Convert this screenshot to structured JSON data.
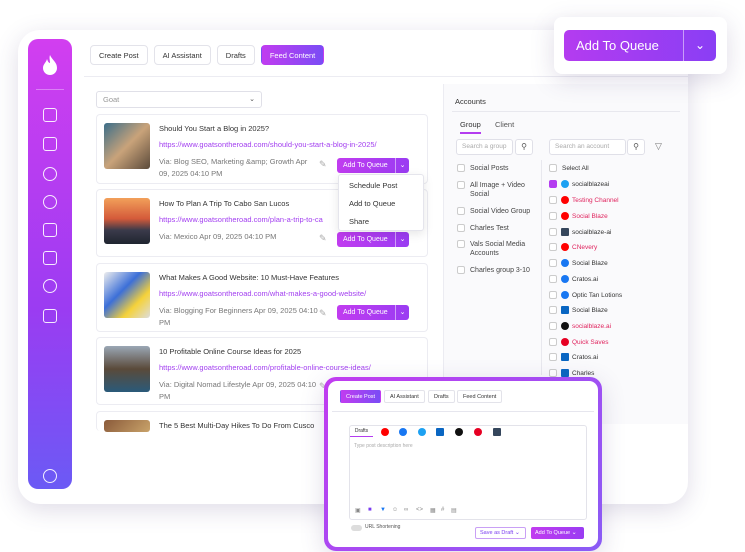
{
  "tabs": [
    "Create Post",
    "AI Assistant",
    "Drafts",
    "Feed Content"
  ],
  "feed_select": {
    "value": "Goat"
  },
  "cards": [
    {
      "title": "Should You Start a Blog in 2025?",
      "url": "https://www.goatsontheroad.com/should-you-start-a-blog-in-2025/",
      "via": "Via: Blog SEO, Marketing &amp; Growth  Apr 09, 2025 04:10 PM",
      "queue": "Add To Queue"
    },
    {
      "title": "How To Plan A Trip To Cabo San Lucos",
      "url": "https://www.goatsontheroad.com/plan-a-trip-to-ca",
      "via": "Via: Mexico   Apr 09, 2025 04:10 PM",
      "queue": "Add To Queue"
    },
    {
      "title": "What Makes A Good Website: 10 Must-Have Features",
      "url": "https://www.goatsontheroad.com/what-makes-a-good-website/",
      "via": "Via: Blogging For Beginners  Apr 09, 2025 04:10 PM",
      "queue": "Add To Queue"
    },
    {
      "title": "10 Profitable Online Course Ideas for 2025",
      "url": "https://www.goatsontheroad.com/profitable-online-course-ideas/",
      "via": "Via: Digital Nomad Lifestyle  Apr 09, 2025 04:10 PM",
      "queue": "Add To Queue"
    },
    {
      "title": "The 5 Best Multi-Day Hikes To Do From Cusco",
      "url": "",
      "via": "",
      "queue": ""
    }
  ],
  "menu": [
    "Schedule Post",
    "Add to Queue",
    "Share"
  ],
  "accounts_panel": {
    "title": "Accounts",
    "tabs": [
      "Group",
      "Client"
    ],
    "group_search_placeholder": "Search a group",
    "account_search_placeholder": "Search an account",
    "groups": [
      "Social Posts",
      "All Image + Video Social",
      "Social Video Group",
      "Charles Test",
      "Vals Social Media Accounts",
      "Charles group 3-10"
    ],
    "select_all": "Select All",
    "accounts": [
      {
        "name": "socialblazeai",
        "checked": true,
        "color": "#1da1f2",
        "error": false
      },
      {
        "name": "Testing Channel",
        "checked": false,
        "color": "#ff0000",
        "error": true
      },
      {
        "name": "Social Blaze",
        "checked": false,
        "color": "#ff0000",
        "error": true
      },
      {
        "name": "socialblaze-ai",
        "checked": false,
        "color": "#35465c",
        "error": false
      },
      {
        "name": "CNevery",
        "checked": false,
        "color": "#ff0000",
        "error": true
      },
      {
        "name": "Social Blaze",
        "checked": false,
        "color": "#1877f2",
        "error": false
      },
      {
        "name": "Cratos.ai",
        "checked": false,
        "color": "#1877f2",
        "error": false
      },
      {
        "name": "Optic Tan Lotions",
        "checked": false,
        "color": "#1877f2",
        "error": false
      },
      {
        "name": "Social Blaze",
        "checked": false,
        "color": "#0a66c2",
        "error": false
      },
      {
        "name": "socialblaze.ai",
        "checked": false,
        "color": "#111111",
        "error": true
      },
      {
        "name": "Quick Saves",
        "checked": false,
        "color": "#e60023",
        "error": true
      },
      {
        "name": "Cratos.ai",
        "checked": false,
        "color": "#0a66c2",
        "error": false
      },
      {
        "name": "Charles",
        "checked": false,
        "color": "#0a66c2",
        "error": false
      }
    ]
  },
  "big_button": {
    "label": "Add To Queue"
  },
  "popup": {
    "tabs": [
      "Create Post",
      "AI Assistant",
      "Drafts",
      "Feed Content"
    ],
    "editor_tab": "Drafts",
    "placeholder": "Type post description here",
    "url_shortening": "URL Shortening",
    "save_draft": "Save as Draft",
    "add_queue": "Add To Queue"
  }
}
